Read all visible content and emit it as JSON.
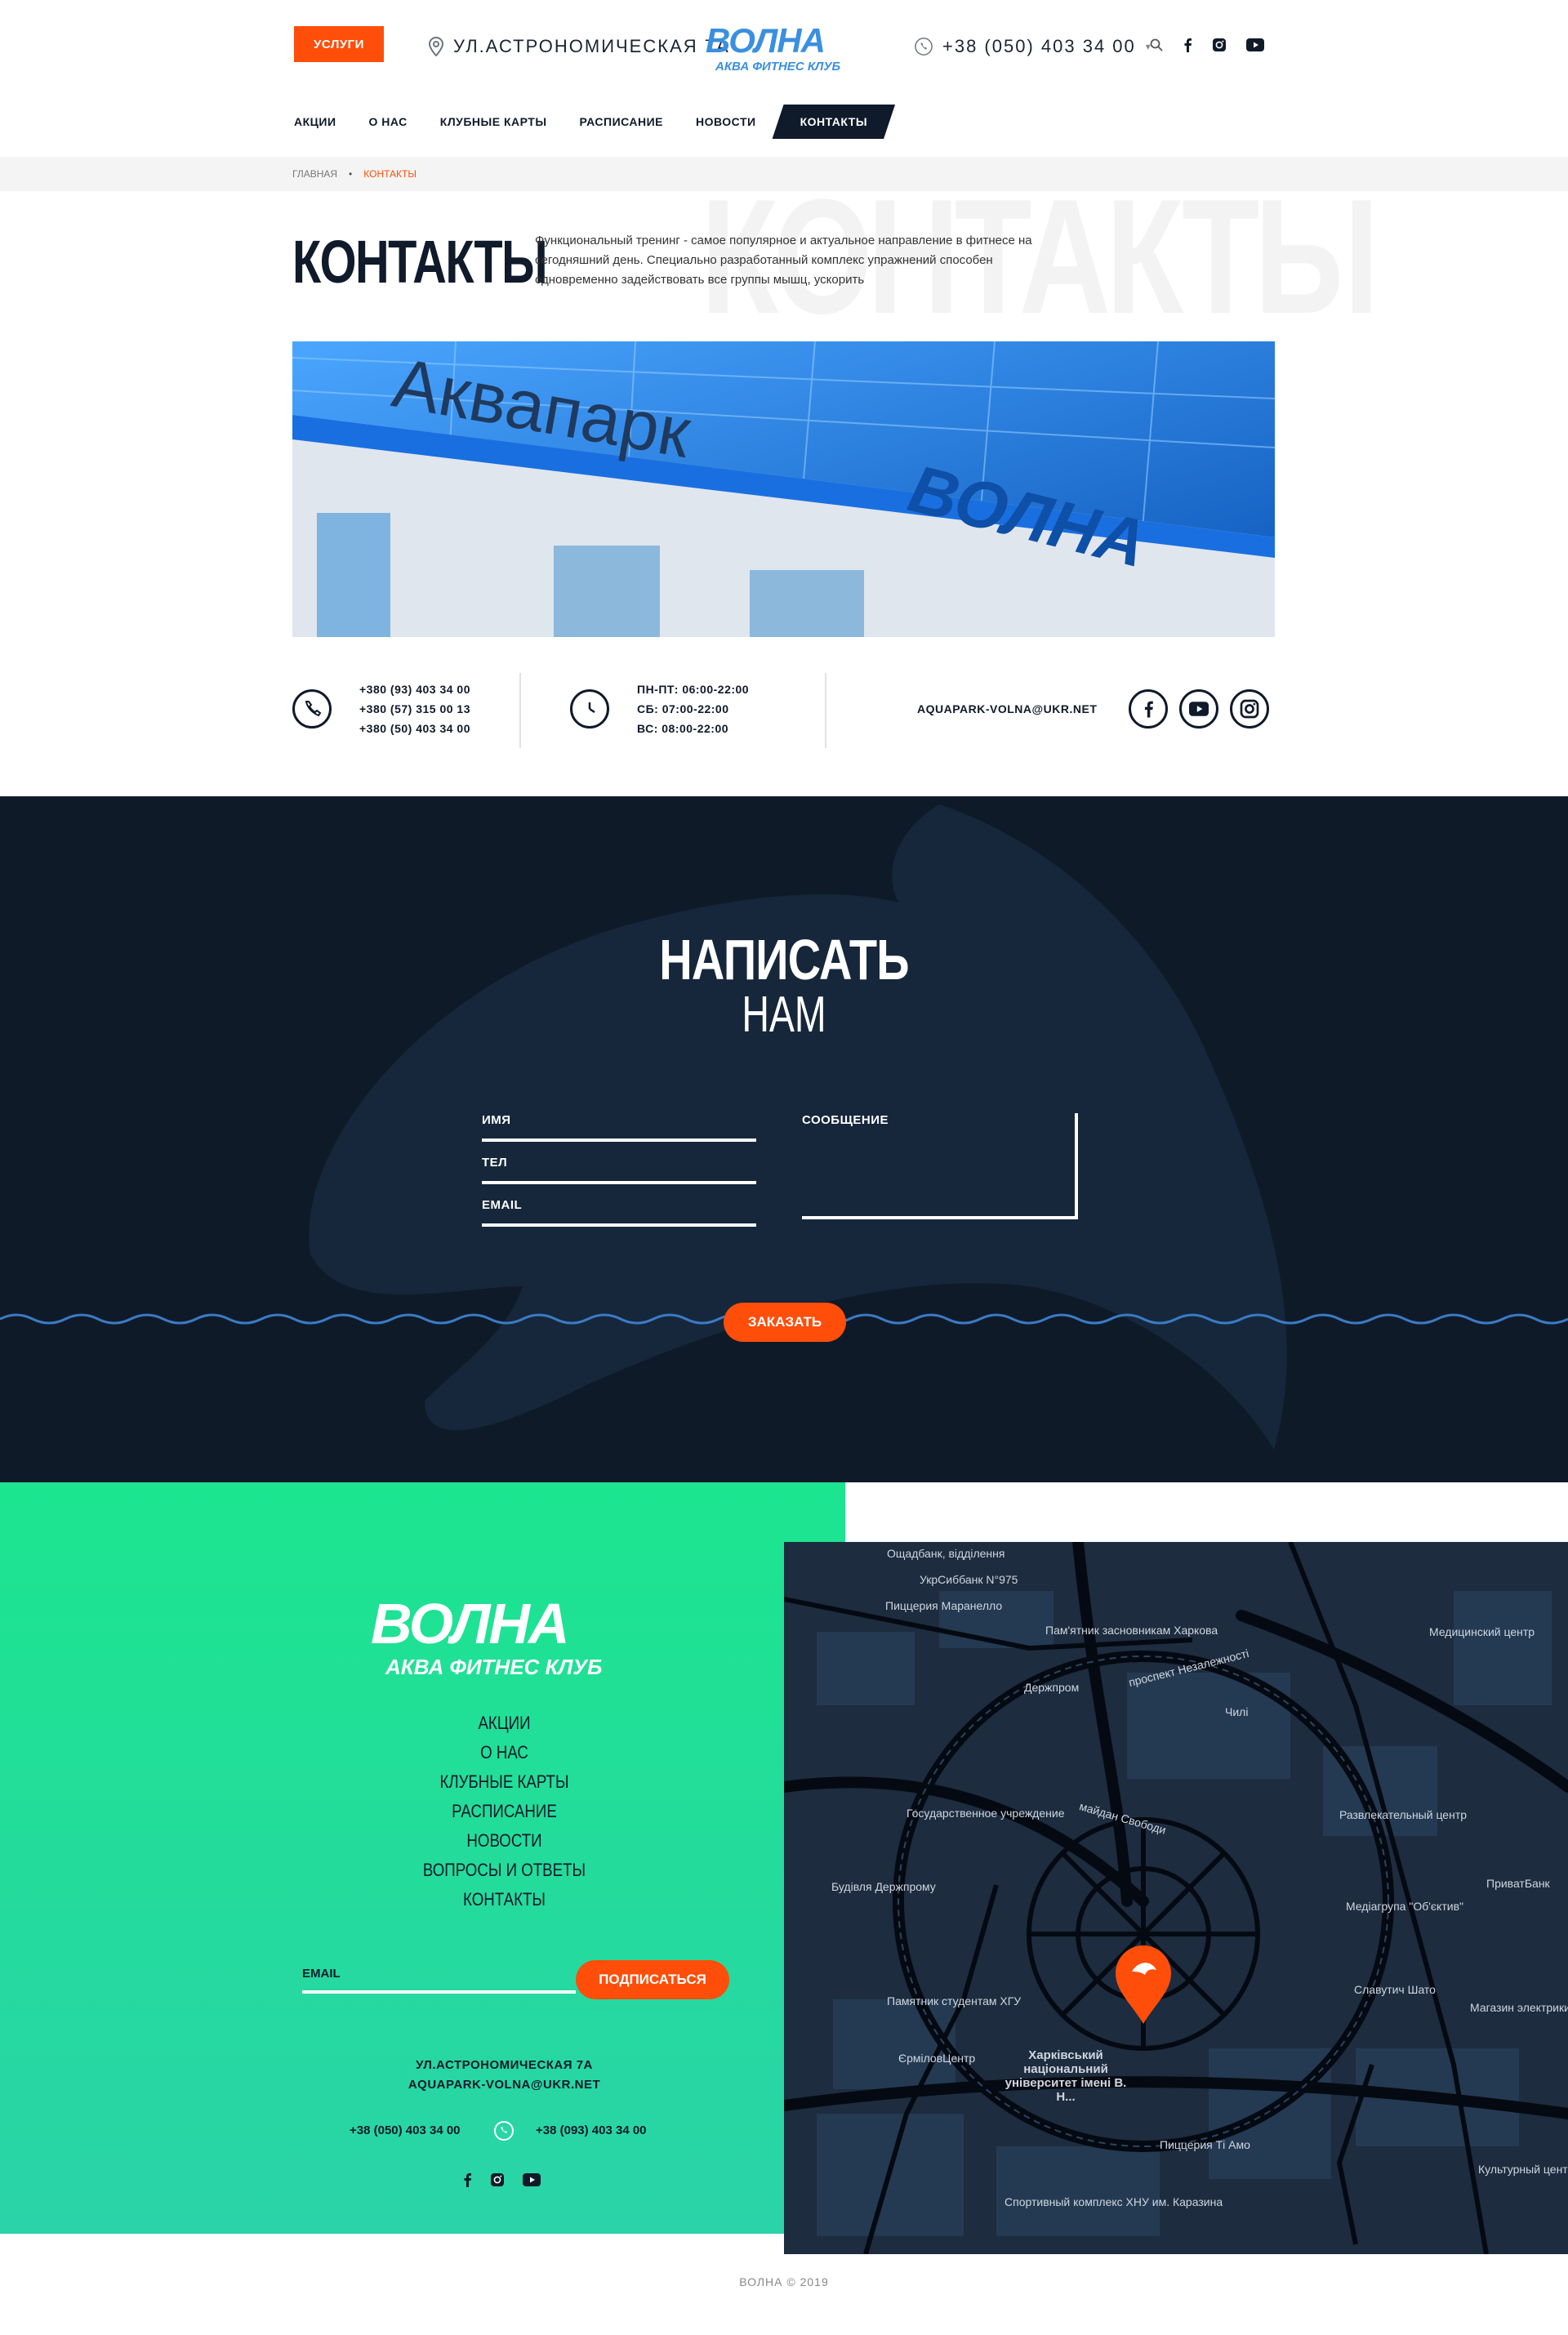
{
  "header": {
    "services_label": "УСЛУГИ",
    "address": "УЛ.АСТРОНОМИЧЕСКАЯ 7А",
    "phone": "+38 (050) 403 34 00",
    "logo_main": "ВОЛНА",
    "logo_sub": "АКВА ФИТНЕС КЛУБ",
    "nav": [
      "АКЦИИ",
      "О НАС",
      "КЛУБНЫЕ КАРТЫ",
      "РАСПИСАНИЕ",
      "НОВОСТИ",
      "КОНТАКТЫ"
    ]
  },
  "breadcrumb": {
    "home": "ГЛАВНАЯ",
    "current": "КОНТАКТЫ"
  },
  "page": {
    "title": "КОНТАКТЫ",
    "bg_title": "КОНТАКТЫ",
    "description": "Функциональный тренинг - самое популярное и актуальное направление в фитнесе на сегодняшний день. Специально разработанный комплекс упражнений способен одновременно задействовать все группы мышц, ускорить"
  },
  "hero": {
    "sign": "Аквапарк",
    "sign2": "ВОЛНА"
  },
  "contacts": {
    "phones": [
      "+380 (93) 403 34 00",
      "+380 (57) 315 00 13",
      "+380 (50) 403 34 00"
    ],
    "hours": [
      "ПН-ПТ: 06:00-22:00",
      "СБ: 07:00-22:00",
      "ВС: 08:00-22:00"
    ],
    "email": "AQUAPARK-VOLNA@UKR.NET"
  },
  "write": {
    "title": "НАПИСАТЬ",
    "subtitle": "НАМ",
    "name_label": "ИМЯ",
    "phone_label": "ТЕЛ",
    "email_label": "EMAIL",
    "message_label": "СООБЩЕНИЕ",
    "submit": "ЗАКАЗАТЬ"
  },
  "footer": {
    "logo_main": "ВОЛНА",
    "logo_sub": "АКВА ФИТНЕС КЛУБ",
    "nav": [
      "АКЦИИ",
      "О НАС",
      "КЛУБНЫЕ КАРТЫ",
      "РАСПИСАНИЕ",
      "НОВОСТИ",
      "ВОПРОСЫ И ОТВЕТЫ",
      "КОНТАКТЫ"
    ],
    "email_placeholder": "EMAIL",
    "subscribe": "ПОДПИСАТЬСЯ",
    "address": "УЛ.АСТРОНОМИЧЕСКАЯ 7А",
    "email": "AQUAPARK-VOLNA@UKR.NET",
    "phone1": "+38 (050) 403 34 00",
    "phone2": "+38 (093) 403 34 00",
    "copyright": "ВОЛНА © 2019"
  },
  "map": {
    "labels": [
      "Ощадбанк, відділення",
      "УкрСиббанк N°975",
      "Пиццерия Маранелло",
      "Пам'ятник засновникам Харкова",
      "проспект Незалежності",
      "Медицинский центр",
      "Держпром",
      "Чилі",
      "Государственное учреждение",
      "Развлекательный центр",
      "Будівля Держпрому",
      "майдан Свободи",
      "Медіагрупа \"Об'єктив\"",
      "ПриватБанк",
      "Памятник студентам ХГУ",
      "Славутич Шато",
      "Магазин электрики",
      "ЄрміловЦентр",
      "Харківський національний університет імені В. Н...",
      "Пиццерия Ті Амо",
      "Спортивный комплекс ХНУ им. Каразина",
      "Культурный центр"
    ]
  },
  "colors": {
    "accent": "#ff4e0a",
    "dark": "#0f1a29",
    "green": "#1ce58f",
    "blue": "#2a8ff0"
  }
}
